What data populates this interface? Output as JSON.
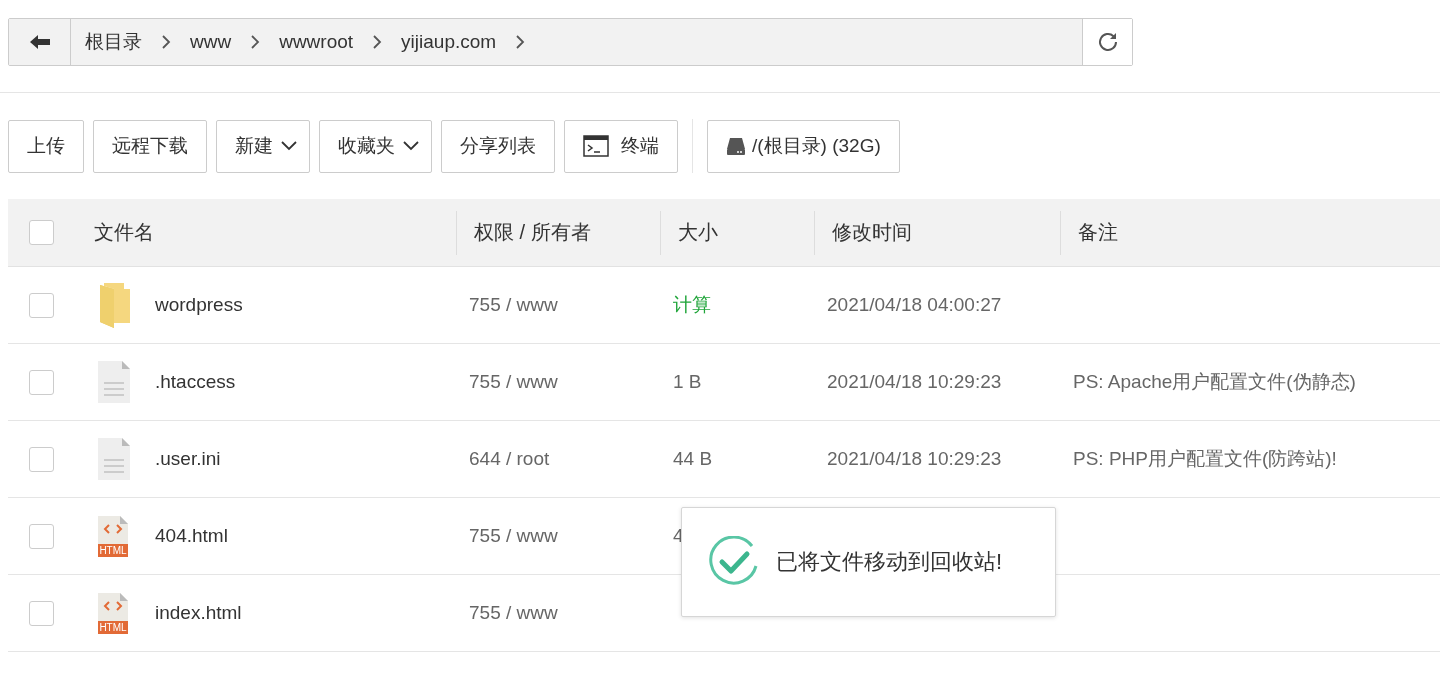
{
  "breadcrumb": {
    "segments": [
      "根目录",
      "www",
      "wwwroot",
      "yijiaup.com"
    ]
  },
  "toolbar": {
    "buttons": [
      {
        "label": "上传",
        "kind": "plain"
      },
      {
        "label": "远程下载",
        "kind": "plain"
      },
      {
        "label": "新建",
        "kind": "dropdown"
      },
      {
        "label": "收藏夹",
        "kind": "dropdown"
      },
      {
        "label": "分享列表",
        "kind": "plain"
      },
      {
        "label": "终端",
        "kind": "terminal"
      },
      {
        "label": "/(根目录) (32G)",
        "kind": "disk"
      }
    ]
  },
  "table": {
    "all_checked": false,
    "columns": [
      "文件名",
      "权限 / 所有者",
      "大小",
      "修改时间",
      "备注"
    ],
    "rows": [
      {
        "kind": "folder",
        "checked": false,
        "name": "wordpress",
        "permission": "755 / www",
        "size": "计算",
        "size_clickable": true,
        "modified": "2021/04/18 04:00:27"
      },
      {
        "kind": "file",
        "checked": false,
        "name": ".htaccess",
        "permission": "755 / www",
        "size": "1 B",
        "modified": "2021/04/18 10:29:23",
        "note": "PS: Apache用户配置文件(伪静态)"
      },
      {
        "kind": "file",
        "checked": false,
        "name": ".user.ini",
        "permission": "644 / root",
        "size": "44 B",
        "modified": "2021/04/18 10:29:23",
        "note": "PS: PHP用户配置文件(防跨站)!"
      },
      {
        "kind": "html",
        "icon_label": "HTML",
        "checked": false,
        "name": "404.html",
        "permission": "755 / www",
        "size": "4"
      },
      {
        "kind": "html",
        "icon_label": "HTML",
        "checked": false,
        "name": "index.html",
        "permission": "755 / www"
      }
    ]
  },
  "toast": {
    "kind": "success",
    "message": "已将文件移动到回收站!"
  }
}
